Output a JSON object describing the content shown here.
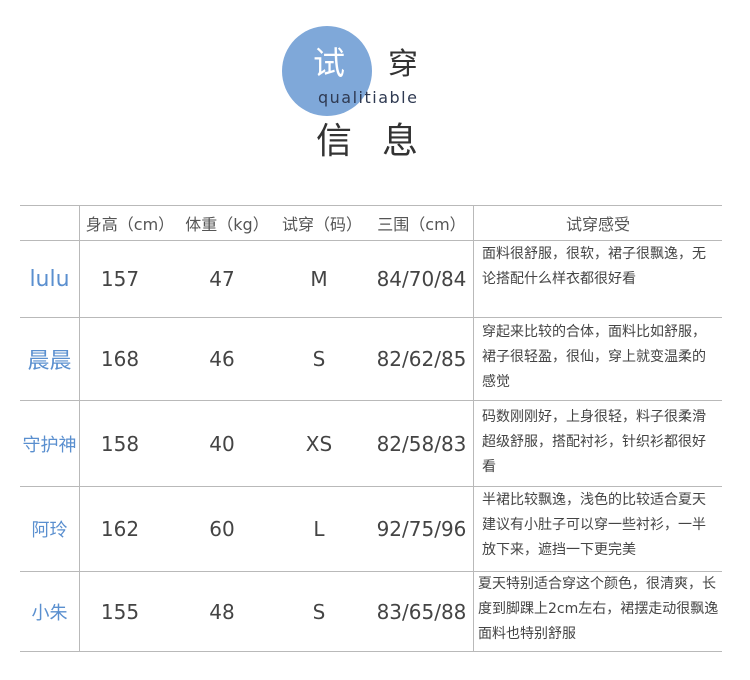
{
  "header": {
    "circle_char": "试",
    "second_char": "穿",
    "english": "qualitiable",
    "subtitle": "信息"
  },
  "table": {
    "columns": [
      "",
      "身高（cm）",
      "体重（kg）",
      "试穿（码）",
      "三围（cm）",
      "试穿感受"
    ],
    "rows": [
      {
        "name": "lulu",
        "height": "157",
        "weight": "47",
        "size": "M",
        "measurements": "84/70/84",
        "feedback": "面料很舒服，很软，裙子很飘逸，无论搭配什么样衣都很好看"
      },
      {
        "name": "晨晨",
        "height": "168",
        "weight": "46",
        "size": "S",
        "measurements": "82/62/85",
        "feedback": "穿起来比较的合体，面料比如舒服，裙子很轻盈，很仙，穿上就变温柔的感觉"
      },
      {
        "name": "守护神",
        "height": "158",
        "weight": "40",
        "size": "XS",
        "measurements": "82/58/83",
        "feedback": "码数刚刚好，上身很轻，料子很柔滑超级舒服，搭配衬衫，针织衫都很好看"
      },
      {
        "name": "阿玲",
        "height": "162",
        "weight": "60",
        "size": "L",
        "measurements": "92/75/96",
        "feedback": "半裙比较飘逸，浅色的比较适合夏天建议有小肚子可以穿一些衬衫，一半放下来，遮挡一下更完美"
      },
      {
        "name": "小朱",
        "height": "155",
        "weight": "48",
        "size": "S",
        "measurements": "83/65/88",
        "feedback": "夏天特别适合穿这个颜色，很清爽，长度到脚踝上2cm左右，裙摆走动很飘逸面料也特别舒服"
      }
    ]
  },
  "colors": {
    "accent": "#7fa8d9",
    "name_text": "#5a8fcf",
    "grid": "#b9b9b9"
  }
}
